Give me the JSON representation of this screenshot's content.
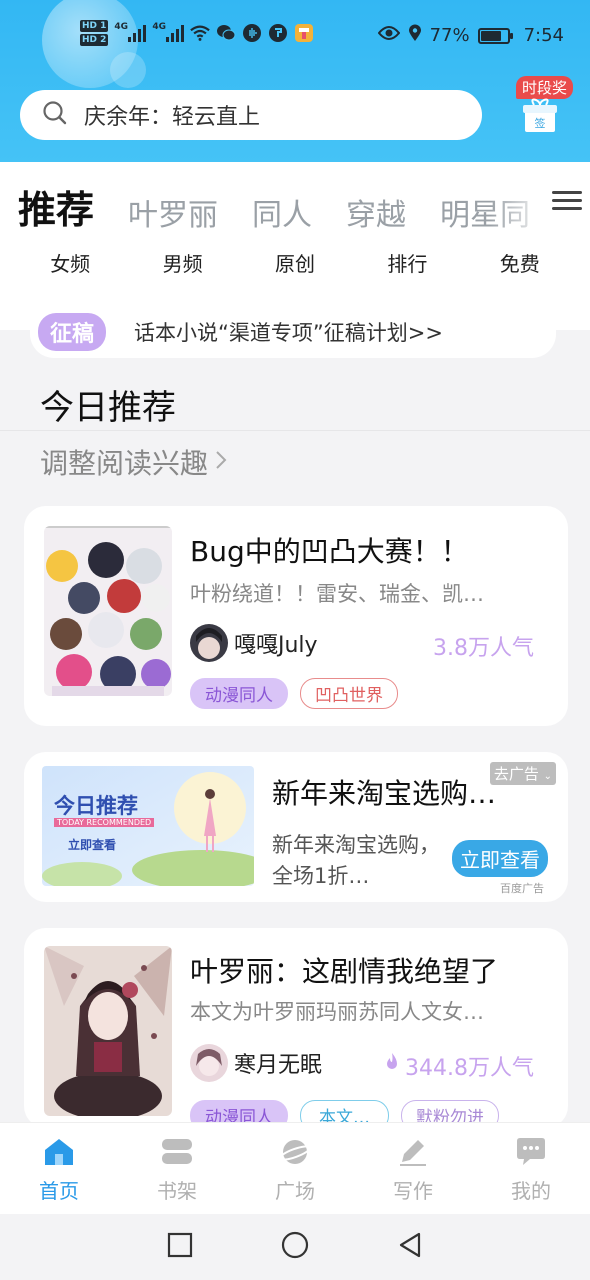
{
  "status_bar": {
    "hd1": "HD 1",
    "hd2": "HD 2",
    "net1": "4G",
    "net2": "4G",
    "battery_pct": "77%",
    "battery_level": 0.77,
    "time": "7:54"
  },
  "search": {
    "query": "庆余年：轻云直上"
  },
  "gift": {
    "badge": "时段奖",
    "box_label": "签"
  },
  "tabs": [
    "推荐",
    "叶罗丽",
    "同人",
    "穿越",
    "明星同"
  ],
  "subtabs": [
    "女频",
    "男频",
    "原创",
    "排行",
    "免费"
  ],
  "notice": {
    "tag": "征稿",
    "text": "话本小说“渠道专项”征稿计划>>"
  },
  "section": {
    "title": "今日推荐",
    "subtitle": "调整阅读兴趣"
  },
  "books": [
    {
      "title": "Bug中的凹凸大赛！！",
      "desc": "叶粉绕道！！雷安、瑞金、凯…",
      "author": "嘎嘎July",
      "popularity": "3.8万人气",
      "tags": [
        "动漫同人",
        "凹凸世界"
      ]
    },
    {
      "title": "叶罗丽：这剧情我绝望了",
      "desc": "本文为叶罗丽玛丽苏同人文女…",
      "author": "寒月无眠",
      "popularity": "344.8万人气",
      "tags": [
        "动漫同人",
        "本文…",
        "默粉勿进"
      ]
    }
  ],
  "ad": {
    "image_title": "今日推荐",
    "image_subtitle": "TODAY RECOMMENDED",
    "image_button": "立即查看",
    "title": "新年来淘宝选购…",
    "desc": "新年来淘宝选购，全场1折…",
    "close_label": "去广告",
    "button": "立即查看",
    "source": "百度广告"
  },
  "bottom_nav": [
    {
      "label": "首页",
      "icon": "home-icon"
    },
    {
      "label": "书架",
      "icon": "bookshelf-icon"
    },
    {
      "label": "广场",
      "icon": "planet-icon"
    },
    {
      "label": "写作",
      "icon": "pen-icon"
    },
    {
      "label": "我的",
      "icon": "chat-icon"
    }
  ],
  "colors": {
    "header": "#3dbdf5",
    "accent_purple": "#b38cf0",
    "nav_active": "#2a9ae8"
  }
}
